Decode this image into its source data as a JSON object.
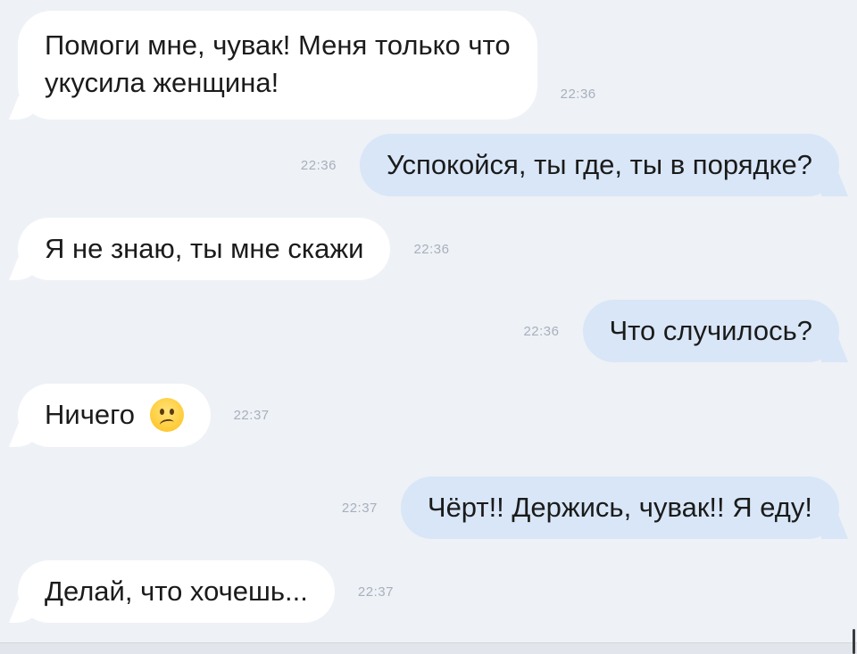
{
  "messages": [
    {
      "direction": "in",
      "text_line1": "Помоги мне, чувак! Меня только что",
      "text_line2": "укусила женщина!",
      "time": "22:36"
    },
    {
      "direction": "out",
      "text": "Успокойся, ты где, ты в порядке?",
      "time": "22:36"
    },
    {
      "direction": "in",
      "text": "Я не знаю, ты мне скажи",
      "time": "22:36"
    },
    {
      "direction": "out",
      "text": "Что случилось?",
      "time": "22:36"
    },
    {
      "direction": "in",
      "text": "Ничего",
      "emoji": "confused-face-icon",
      "time": "22:37"
    },
    {
      "direction": "out",
      "text": "Чёрт!! Держись, чувак!! Я еду!",
      "time": "22:37"
    },
    {
      "direction": "in",
      "text": "Делай, что хочешь...",
      "time": "22:37"
    }
  ],
  "colors": {
    "background": "#eef1f6",
    "incoming_bubble": "#ffffff",
    "outgoing_bubble": "#d8e6f7",
    "timestamp": "#a7b0bc"
  }
}
